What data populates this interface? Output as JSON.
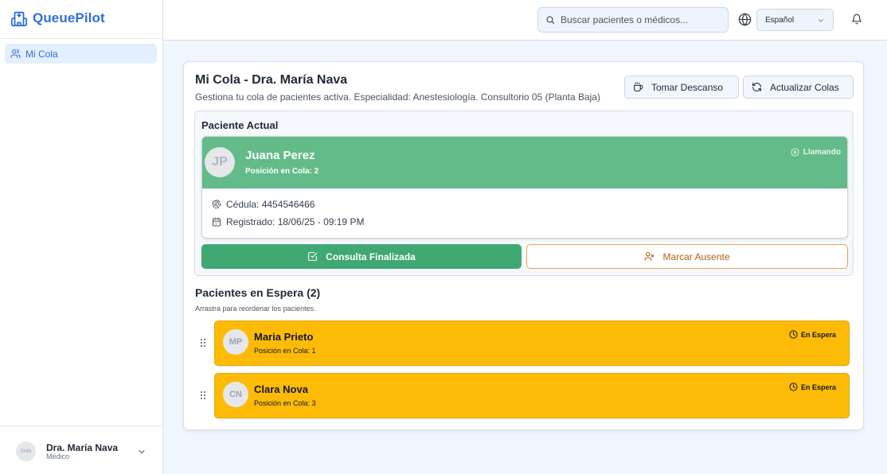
{
  "app": {
    "name": "QueuePilot"
  },
  "sidebar": {
    "items": [
      {
        "label": "Mi Cola",
        "icon": "users-icon",
        "active": true
      }
    ],
    "user": {
      "initials": "DMN",
      "name": "Dra. María Nava",
      "role": "Médico"
    }
  },
  "header": {
    "search_placeholder": "Buscar pacientes o médicos...",
    "language": "Español"
  },
  "main": {
    "title": "Mi Cola - Dra. María Nava",
    "subtitle": "Gestiona tu cola de pacientes activa. Especialidad: Anestesiología. Consultorio 05 (Planta Baja)",
    "break_button": "Tomar Descanso",
    "refresh_button": "Actualizar Colas",
    "current": {
      "section_title": "Paciente Actual",
      "initials": "JP",
      "name": "Juana Perez",
      "position": "Posición en Cola: 2",
      "status": "Llamando",
      "id_label": "Cédula: 4454546466",
      "registered_label": "Registrado: 18/06/25 - 09:19 PM",
      "finish_button": "Consulta Finalizada",
      "absent_button": "Marcar Ausente"
    },
    "waiting": {
      "title": "Pacientes en Espera (2)",
      "hint": "Arrastra para reordenar los pacientes.",
      "items": [
        {
          "initials": "MP",
          "name": "Maria Prieto",
          "position": "Posición en Cola: 1",
          "status": "En Espera"
        },
        {
          "initials": "CN",
          "name": "Clara Nova",
          "position": "Posición en Cola: 3",
          "status": "En Espera"
        }
      ]
    }
  },
  "colors": {
    "brand": "#2f6fd8",
    "calling_band": "#63bb8a",
    "finish_button": "#40a872",
    "absent_border": "#e8a64b",
    "waiting_card": "#fdbb08"
  }
}
